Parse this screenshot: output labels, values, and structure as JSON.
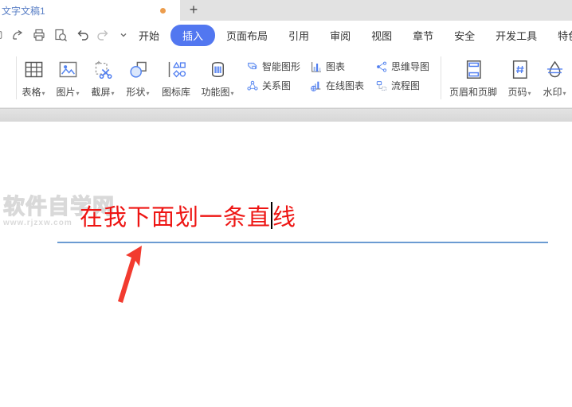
{
  "titlebar": {
    "doc_title": "文字文稿1",
    "new_tab_label": "+"
  },
  "menubar": {
    "items": [
      {
        "label": "开始"
      },
      {
        "label": "插入"
      },
      {
        "label": "页面布局"
      },
      {
        "label": "引用"
      },
      {
        "label": "审阅"
      },
      {
        "label": "视图"
      },
      {
        "label": "章节"
      },
      {
        "label": "安全"
      },
      {
        "label": "开发工具"
      },
      {
        "label": "特色应用"
      }
    ],
    "active_item": "插入"
  },
  "ribbon": {
    "dropdown_glyph": "▾",
    "big_buttons": [
      {
        "label": "表格",
        "dropdown": true
      },
      {
        "label": "图片",
        "dropdown": true
      },
      {
        "label": "截屏",
        "dropdown": true
      },
      {
        "label": "形状",
        "dropdown": true
      },
      {
        "label": "图标库",
        "dropdown": false
      },
      {
        "label": "功能图",
        "dropdown": true
      }
    ],
    "small_buttons": [
      {
        "label": "智能图形"
      },
      {
        "label": "关系图"
      },
      {
        "label": "图表"
      },
      {
        "label": "在线图表"
      },
      {
        "label": "思维导图"
      },
      {
        "label": "流程图"
      }
    ],
    "right_buttons": [
      {
        "label": "页眉和页脚",
        "dropdown": false
      },
      {
        "label": "页码",
        "dropdown": true
      },
      {
        "label": "水印",
        "dropdown": true
      }
    ]
  },
  "document": {
    "text_before_caret": "在我下面划一条直",
    "text_after_caret": "线",
    "text_color": "#ee1412",
    "line_color": "#6b9bd2",
    "arrow_color": "#f23b2f",
    "watermark_title": "软件自学网",
    "watermark_url": "www.rjzxw.com"
  },
  "colors": {
    "accent_blue": "#5277f0",
    "icon_blue": "#4f7df0",
    "icon_gray": "#5a5a5a",
    "tab_title_blue": "#5b80c6",
    "unsaved_dot_orange": "#ec9d4d"
  }
}
